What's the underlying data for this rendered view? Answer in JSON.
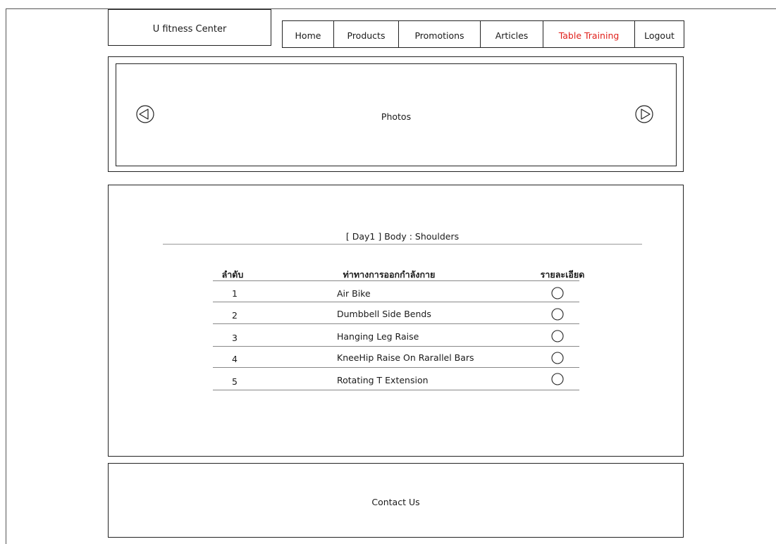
{
  "header": {
    "logo_text": "U fitness Center"
  },
  "nav": {
    "items": [
      {
        "label": "Home"
      },
      {
        "label": "Products"
      },
      {
        "label": "Promotions"
      },
      {
        "label": "Articles"
      },
      {
        "label": "Table Training"
      },
      {
        "label": "Logout"
      }
    ],
    "active_label": "Table Training",
    "active_color": "#e0201b"
  },
  "slider": {
    "label": "Photos",
    "prev_icon": "triangle-left-circle-icon",
    "next_icon": "triangle-right-circle-icon"
  },
  "training": {
    "title": "[ Day1 ] Body : Shoulders",
    "headers": {
      "order": "ลำดับ",
      "exercise": "ท่าทางการออกกำลังกาย",
      "detail": "รายละเอียด"
    },
    "rows": [
      {
        "num": "1",
        "name": "Air Bike"
      },
      {
        "num": "2",
        "name": "Dumbbell Side Bends"
      },
      {
        "num": "3",
        "name": "Hanging Leg Raise"
      },
      {
        "num": "4",
        "name": "KneeHip Raise On Rarallel Bars"
      },
      {
        "num": "5",
        "name": "Rotating T Extension"
      }
    ]
  },
  "footer": {
    "label": "Contact Us"
  }
}
